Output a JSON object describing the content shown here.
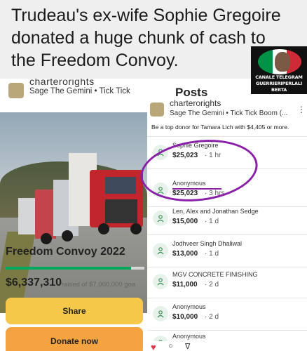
{
  "headline": {
    "line1": "Trudeau's ex-wife Sophie Gregoire",
    "line2": "donated a huge chunk of cash to",
    "line3": "the Freedom Convoy."
  },
  "badge": {
    "line1": "CANALE TELEGRAM",
    "line2": "GUERRIERIPERLALI",
    "line3": "BERTA",
    "colors": [
      "#009246",
      "#ffffff",
      "#ce2b37"
    ]
  },
  "left": {
    "organizer": "charterorights",
    "organizer_sub": "Sage The Gemini • Tick Tick",
    "title": "Freedom Convoy 2022",
    "amount": "$6,337,310",
    "goal": "raised of $7,000,000 goa",
    "progress_fraction": 0.905,
    "share_label": "Share",
    "donate_label": "Donate now"
  },
  "right": {
    "back_glyph": "←",
    "title": "Posts",
    "organizer": "charterorights",
    "organizer_sub": "Sage The Gemini • Tick Tick Boom (...",
    "top_donor": "Be a top donor for Tamara Lich with $4,405 or more.",
    "donors": [
      {
        "name": "Sophie Gregoire",
        "amount": "$25,023",
        "time": "· 1 hr"
      },
      {
        "name": "Anonymous",
        "amount": "$25,023",
        "time": "· 3 hrs"
      },
      {
        "name": "Len, Alex and Jonathan Sedge",
        "amount": "$15,000",
        "time": "· 1 d"
      },
      {
        "name": "Jodhveer Singh Dhaliwal",
        "amount": "$13,000",
        "time": "· 1 d"
      },
      {
        "name": "MGV CONCRETE FINISHING",
        "amount": "$11,000",
        "time": "· 2 d"
      },
      {
        "name": "Anonymous",
        "amount": "$10,000",
        "time": "· 2 d"
      },
      {
        "name": "Anonymous",
        "amount": "",
        "time": ""
      }
    ]
  },
  "bottom": {
    "heart": "♥",
    "comment": "○",
    "send": "∇"
  }
}
